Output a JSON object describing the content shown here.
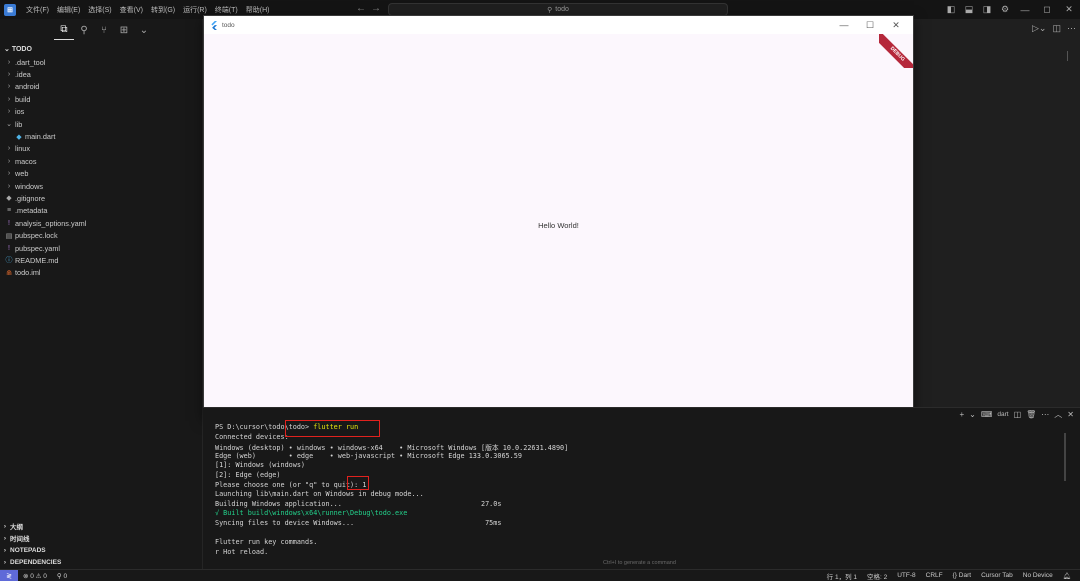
{
  "titlebar": {
    "menus": [
      "文件(F)",
      "编辑(E)",
      "选择(S)",
      "查看(V)",
      "转到(G)",
      "运行(R)",
      "终端(T)",
      "帮助(H)"
    ],
    "search_text": "todo"
  },
  "sidebar": {
    "root_label": "TODO",
    "items": [
      {
        "label": ".dart_tool",
        "type": "folder",
        "chev": "›",
        "icon": ""
      },
      {
        "label": ".idea",
        "type": "folder",
        "chev": "›",
        "icon": ""
      },
      {
        "label": "android",
        "type": "folder",
        "chev": "›",
        "icon": ""
      },
      {
        "label": "build",
        "type": "folder",
        "chev": "›",
        "icon": ""
      },
      {
        "label": "ios",
        "type": "folder",
        "chev": "›",
        "icon": ""
      },
      {
        "label": "lib",
        "type": "folder-open",
        "chev": "⌄",
        "icon": ""
      },
      {
        "label": "main.dart",
        "type": "dart-file",
        "chev": "",
        "icon": "◆"
      },
      {
        "label": "linux",
        "type": "folder",
        "chev": "›",
        "icon": ""
      },
      {
        "label": "macos",
        "type": "folder",
        "chev": "›",
        "icon": ""
      },
      {
        "label": "web",
        "type": "folder",
        "chev": "›",
        "icon": ""
      },
      {
        "label": "windows",
        "type": "folder",
        "chev": "›",
        "icon": ""
      },
      {
        "label": ".gitignore",
        "type": "file",
        "chev": "",
        "icon": "◆"
      },
      {
        "label": ".metadata",
        "type": "file",
        "chev": "",
        "icon": "≡"
      },
      {
        "label": "analysis_options.yaml",
        "type": "yaml-file",
        "chev": "",
        "icon": "!"
      },
      {
        "label": "pubspec.lock",
        "type": "file",
        "chev": "",
        "icon": "▤"
      },
      {
        "label": "pubspec.yaml",
        "type": "yaml-file",
        "chev": "",
        "icon": "!"
      },
      {
        "label": "README.md",
        "type": "md-file",
        "chev": "",
        "icon": "ⓘ"
      },
      {
        "label": "todo.iml",
        "type": "iml-file",
        "chev": "",
        "icon": "⋒"
      }
    ],
    "sections": [
      "大纲",
      "时间线",
      "NOTEPADS",
      "DEPENDENCIES"
    ]
  },
  "flutter_window": {
    "title": "todo",
    "content": "Hello World!",
    "banner": "DEBUG"
  },
  "panel": {
    "actions": [
      "+",
      "⌄",
      "dart"
    ]
  },
  "terminal": {
    "lines": [
      {
        "text": "PS D:\\cursor\\todo\\todo> flutter run",
        "color": ""
      },
      {
        "text": "Connected devices:",
        "color": ""
      },
      {
        "text": "Windows (desktop) • windows • windows-x64    • Microsoft Windows [版本 10.0.22631.4890]",
        "color": ""
      },
      {
        "text": "Edge (web)        • edge    • web-javascript • Microsoft Edge 133.0.3065.59",
        "color": ""
      },
      {
        "text": "[1]: Windows (windows)",
        "color": ""
      },
      {
        "text": "[2]: Edge (edge)",
        "color": ""
      },
      {
        "text": "Please choose one (or \"q\" to quit): 1",
        "color": ""
      },
      {
        "text": "Launching lib\\main.dart on Windows in debug mode...",
        "color": ""
      },
      {
        "text": "Building Windows application...                                  27.0s",
        "color": ""
      },
      {
        "text": "√ Built build\\windows\\x64\\runner\\Debug\\todo.exe",
        "color": "green"
      },
      {
        "text": "Syncing files to device Windows...                                75ms",
        "color": ""
      },
      {
        "text": "",
        "color": ""
      },
      {
        "text": "Flutter run key commands.",
        "color": ""
      },
      {
        "text": "r Hot reload.",
        "color": ""
      }
    ],
    "hint": "Ctrl+I to generate a command"
  },
  "statusbar": {
    "problems": "⊗ 0 ⚠ 0",
    "ports": "⚲ 0",
    "position": "行 1，列 1",
    "spaces": "空格: 2",
    "encoding": "UTF-8",
    "eol": "CRLF",
    "language": "{} Dart",
    "cursor_tab": "Cursor Tab",
    "device": "No Device"
  },
  "colors": {
    "accent": "#5f6ad8",
    "highlight_box": "#e0221e",
    "success": "#23d18b",
    "flutter_bg": "#fcf7fd"
  }
}
